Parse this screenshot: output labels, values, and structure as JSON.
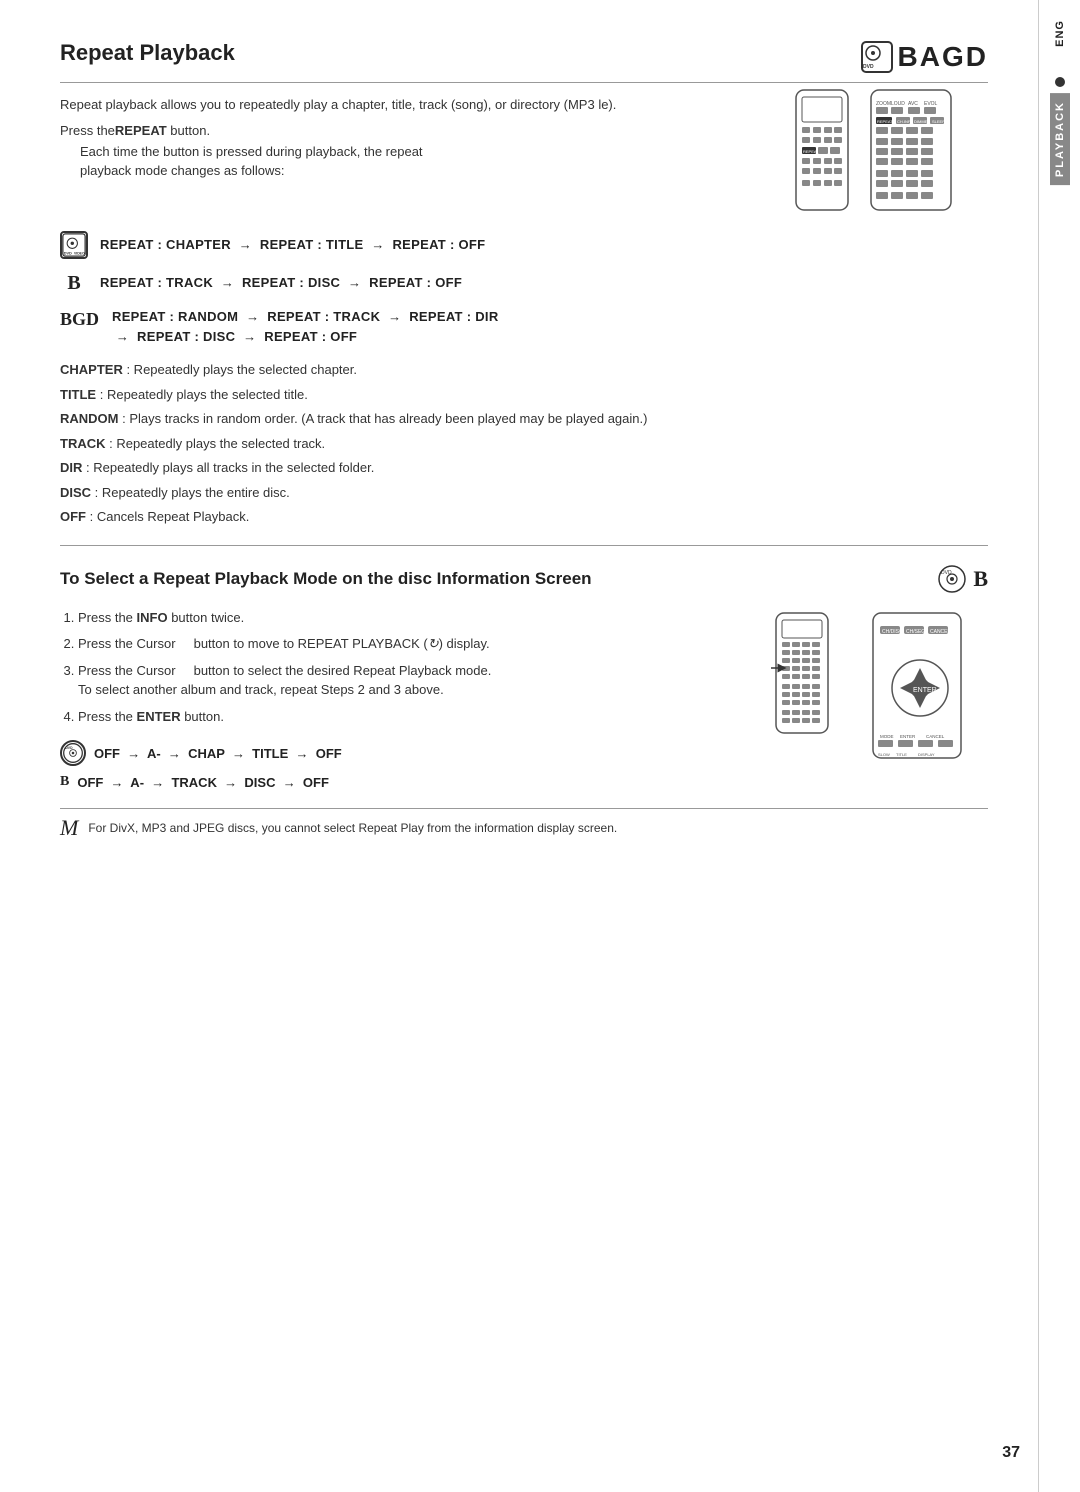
{
  "page": {
    "number": "37",
    "lang_label": "ENG",
    "playback_label": "PLAYBACK"
  },
  "section1": {
    "title": "Repeat Playback",
    "logo": "BAGD",
    "intro": "Repeat playback allows you to repeatedly play a chapter, title, track (song), or directory (MP3  le).",
    "press_label": "Press the",
    "press_button": "REPEAT",
    "press_suffix": " button.",
    "desc1": "Each time the button is pressed during playback, the repeat",
    "desc2": "playback mode changes as follows:",
    "modes": [
      {
        "icon_type": "dvd",
        "icon_label": "DVD VIDEO",
        "text": "REPEAT : CHAPTER  →  REPEAT : TITLE  →  REPEAT : OFF"
      },
      {
        "icon_type": "B",
        "icon_label": "B",
        "text": "REPEAT : TRACK  →  REPEAT : DISC  →  REPEAT : OFF"
      },
      {
        "icon_type": "BGD",
        "icon_label": "BGD",
        "text": "REPEAT : RANDOM  →  REPEAT : TRACK  →  REPEAT : DIR\n→  REPEAT : DISC  →  REPEAT : OFF"
      }
    ],
    "descriptions": [
      {
        "key": "CHAPTER",
        "text": " : Repeatedly plays the selected chapter."
      },
      {
        "key": "TITLE",
        "text": " : Repeatedly plays the selected title."
      },
      {
        "key": "RANDOM",
        "text": " : Plays tracks in random order. (A track that has already been played may be played again.)"
      },
      {
        "key": "TRACK",
        "text": " : Repeatedly plays the selected track."
      },
      {
        "key": "DIR",
        "text": " : Repeatedly plays all tracks in the selected folder."
      },
      {
        "key": "DISC",
        "text": " : Repeatedly plays the entire disc."
      },
      {
        "key": "OFF",
        "text": " : Cancels Repeat Playback."
      }
    ]
  },
  "section2": {
    "title": "To Select a Repeat Playback Mode on the disc Information Screen",
    "steps": [
      {
        "num": 1,
        "text": "Press the",
        "bold": "INFO",
        "suffix": " button twice."
      },
      {
        "num": 2,
        "text": "Press the Cursor    button to move to REPEAT PLAYBACK (",
        "suffix": ") display."
      },
      {
        "num": 3,
        "text": "Press the Cursor    button to select the desired Repeat Playback mode.",
        "extra": "To select another album and track, repeat Steps 2 and 3 above."
      },
      {
        "num": 4,
        "text": "Press the",
        "bold": "ENTER",
        "suffix": " button."
      }
    ],
    "seq_lines": [
      {
        "icon_type": "dvd_circle",
        "icon_label": "DVD",
        "text": "OFF  →  A-  →  CHAP  →  TITLE  →  OFF"
      },
      {
        "icon_type": "B_plain",
        "icon_label": "B",
        "text": "OFF  →  A-  →  TRACK  →  DISC  →  OFF"
      }
    ]
  },
  "note": {
    "prefix": "M",
    "text": "For DivX, MP3 and JPEG discs, you cannot select Repeat Play from the information display screen."
  }
}
